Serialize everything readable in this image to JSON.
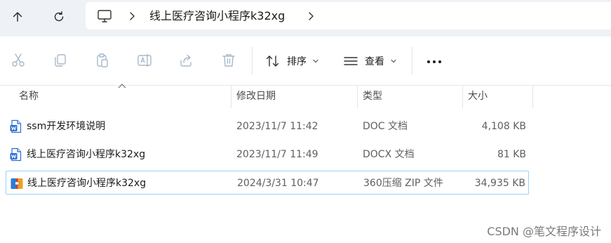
{
  "navigation": {
    "up_icon": "arrow-up-icon",
    "refresh_icon": "refresh-icon",
    "location_icon": "monitor-icon",
    "current_folder": "线上医疗咨询小程序k32xg"
  },
  "toolbar": {
    "disabled_icons": [
      "cut-icon",
      "copy-icon",
      "paste-icon",
      "rename-icon",
      "share-icon",
      "delete-icon"
    ],
    "sort_label": "排序",
    "view_label": "查看",
    "more_icon": "more-icon"
  },
  "columns": {
    "name": "名称",
    "modified": "修改日期",
    "type": "类型",
    "size": "大小"
  },
  "files": [
    {
      "name": "ssm开发环境说明",
      "modified": "2023/11/7 11:42",
      "type": "DOC 文档",
      "size": "4,108 KB",
      "icon": "word-doc-icon"
    },
    {
      "name": "线上医疗咨询小程序k32xg",
      "modified": "2023/11/7 11:49",
      "type": "DOCX 文档",
      "size": "81 KB",
      "icon": "word-doc-icon"
    },
    {
      "name": "线上医疗咨询小程序k32xg",
      "modified": "2024/3/31 10:47",
      "type": "360压缩 ZIP 文件",
      "size": "34,935 KB",
      "icon": "zip-archive-icon",
      "selected": true
    }
  ],
  "watermark": "CSDN @笔文程序设计",
  "colors": {
    "address_bar_bg": "#eef1f6",
    "selection_border": "#99d1f3",
    "word_blue": "#2b6cd8",
    "disabled_icon": "#a8b8c8"
  }
}
